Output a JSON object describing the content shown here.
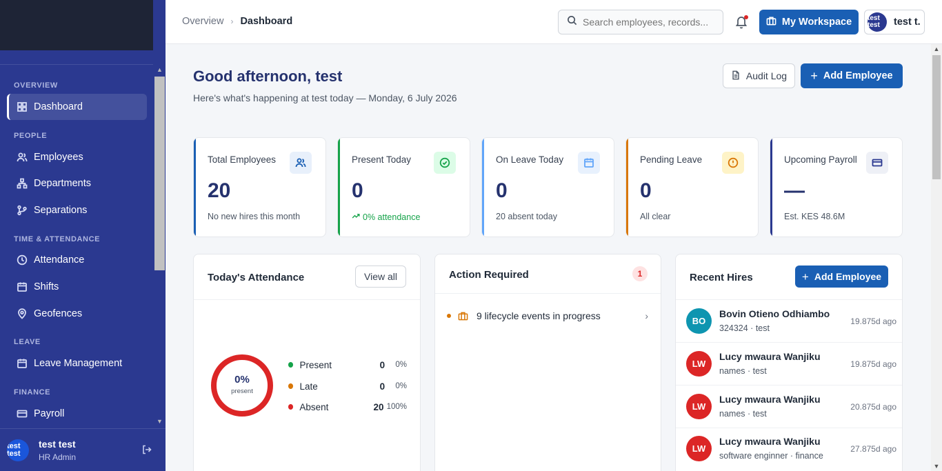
{
  "sidebar": {
    "sections": {
      "overview": "OVERVIEW",
      "people": "PEOPLE",
      "time": "TIME & ATTENDANCE",
      "leave": "LEAVE",
      "finance": "FINANCE"
    },
    "items": {
      "dashboard": "Dashboard",
      "employees": "Employees",
      "departments": "Departments",
      "separations": "Separations",
      "attendance": "Attendance",
      "shifts": "Shifts",
      "geofences": "Geofences",
      "leave_management": "Leave Management",
      "payroll": "Payroll"
    },
    "footer": {
      "avatar": "test test",
      "name": "test test",
      "role": "HR Admin"
    },
    "colors": {
      "background": "#2b3990"
    }
  },
  "topbar": {
    "breadcrumb": {
      "parent": "Overview",
      "current": "Dashboard"
    },
    "search": {
      "placeholder": "Search employees, records..."
    },
    "workspace_button": "My Workspace",
    "user": {
      "avatar": "test test",
      "label": "test t."
    }
  },
  "header": {
    "greeting": "Good afternoon, test",
    "subtitle": "Here's what's happening at test today — Monday, 6 July 2026",
    "audit_log": "Audit Log",
    "add_employee": "Add Employee"
  },
  "stats": [
    {
      "label": "Total Employees",
      "value": "20",
      "sub": "No new hires this month",
      "accent": "#1a5fb4",
      "icon": "users-icon"
    },
    {
      "label": "Present Today",
      "value": "0",
      "sub": "0% attendance",
      "accent": "#16a34a",
      "icon": "check-circle-icon"
    },
    {
      "label": "On Leave Today",
      "value": "0",
      "sub": "20 absent today",
      "accent": "#60a5fa",
      "icon": "calendar-icon"
    },
    {
      "label": "Pending Leave",
      "value": "0",
      "sub": "All clear",
      "accent": "#d97706",
      "icon": "alert-circle-icon"
    },
    {
      "label": "Upcoming Payroll",
      "value": "—",
      "sub": "Est. KES 48.6M",
      "accent": "#2b3990",
      "icon": "credit-card-icon"
    }
  ],
  "attendance": {
    "title": "Today's Attendance",
    "view_all": "View all",
    "center_value": "0%",
    "center_label": "present",
    "present_fraction": 0,
    "legend": [
      {
        "name": "Present",
        "count": "0",
        "pct": "0%",
        "color": "#16a34a"
      },
      {
        "name": "Late",
        "count": "0",
        "pct": "0%",
        "color": "#d97706"
      },
      {
        "name": "Absent",
        "count": "20",
        "pct": "100%",
        "color": "#dc2626"
      }
    ]
  },
  "actions": {
    "title": "Action Required",
    "badge": "1",
    "items": [
      {
        "text": "9 lifecycle events in progress",
        "icon": "briefcase-icon"
      }
    ]
  },
  "hires": {
    "title": "Recent Hires",
    "add_button": "Add Employee",
    "rows": [
      {
        "initials": "BO",
        "name": "Bovin Otieno Odhiambo",
        "meta": "324324 · test",
        "ago": "19.875d ago",
        "color": "#0e95b0"
      },
      {
        "initials": "LW",
        "name": "Lucy mwaura Wanjiku",
        "meta": "names · test",
        "ago": "19.875d ago",
        "color": "#dc2626"
      },
      {
        "initials": "LW",
        "name": "Lucy mwaura Wanjiku",
        "meta": "names · test",
        "ago": "20.875d ago",
        "color": "#dc2626"
      },
      {
        "initials": "LW",
        "name": "Lucy mwaura Wanjiku",
        "meta": "software enginner · finance",
        "ago": "27.875d ago",
        "color": "#dc2626"
      }
    ]
  }
}
